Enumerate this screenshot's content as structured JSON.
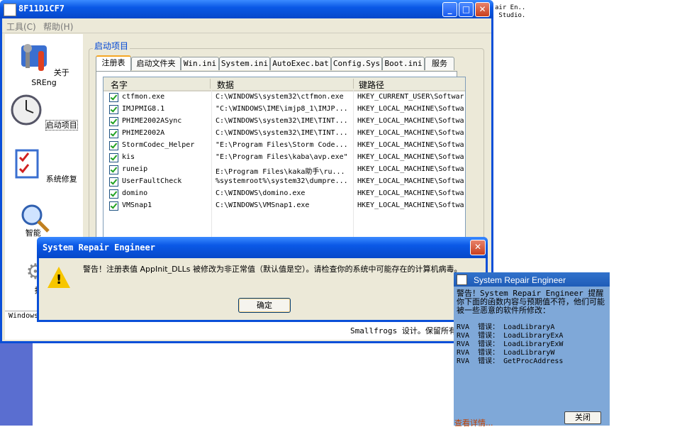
{
  "behind_text": "air En..\n Studio.",
  "main_window": {
    "title": "8F11D1CF7",
    "menu": [
      "工具(C)",
      "帮助(H)"
    ],
    "sidebar": [
      {
        "label": "关于 SREng",
        "icon": "tools-icon"
      },
      {
        "label": "启动项目",
        "icon": "clock-icon"
      },
      {
        "label": "系统修复",
        "icon": "checklist-icon"
      },
      {
        "label": "智能",
        "icon": "magnifier-icon"
      },
      {
        "label": "扫",
        "icon": "gear-icon"
      }
    ],
    "group_label": "启动项目",
    "tabs": [
      "注册表",
      "启动文件夹",
      "Win.ini",
      "System.ini",
      "AutoExec.bat",
      "Config.Sys",
      "Boot.ini",
      "服务"
    ],
    "columns": [
      "名字",
      "数据",
      "键路径"
    ],
    "rows": [
      {
        "name": "ctfmon.exe",
        "data": "C:\\WINDOWS\\system32\\ctfmon.exe",
        "key": "HKEY_CURRENT_USER\\Softwar"
      },
      {
        "name": "IMJPMIG8.1",
        "data": "\"C:\\WINDOWS\\IME\\imjp8_1\\IMJP...",
        "key": "HKEY_LOCAL_MACHINE\\Softwa"
      },
      {
        "name": "PHIME2002ASync",
        "data": "C:\\WINDOWS\\system32\\IME\\TINT...",
        "key": "HKEY_LOCAL_MACHINE\\Softwa"
      },
      {
        "name": "PHIME2002A",
        "data": "C:\\WINDOWS\\system32\\IME\\TINT...",
        "key": "HKEY_LOCAL_MACHINE\\Softwa"
      },
      {
        "name": "StormCodec_Helper",
        "data": "\"E:\\Program Files\\Storm Code...",
        "key": "HKEY_LOCAL_MACHINE\\Softwa"
      },
      {
        "name": "kis",
        "data": "\"E:\\Program Files\\kaba\\avp.exe\"",
        "key": "HKEY_LOCAL_MACHINE\\Softwa"
      },
      {
        "name": "runeip",
        "data": "E:\\Program Files\\kaka助手\\ru...",
        "key": "HKEY_LOCAL_MACHINE\\Softwa"
      },
      {
        "name": "UserFaultCheck",
        "data": "%systemroot%\\system32\\dumpre...",
        "key": "HKEY_LOCAL_MACHINE\\Softwa"
      },
      {
        "name": "domino",
        "data": "C:\\WINDOWS\\domino.exe",
        "key": "HKEY_LOCAL_MACHINE\\Softwa"
      },
      {
        "name": "VMSnap1",
        "data": "C:\\WINDOWS\\VMSnap1.exe",
        "key": "HKEY_LOCAL_MACHINE\\Softwa"
      }
    ],
    "status_left": "Windows",
    "credit": "Smallfrogs 设计。保留所有"
  },
  "alert": {
    "title": "System Repair Engineer",
    "message": "警告！注册表值 AppInit_DLLs 被修改为非正常值（默认值是空）。请检查你的系统中可能存在的计算机病毒。",
    "ok": "确定"
  },
  "notification": {
    "title": "System Repair Engineer",
    "message": "警告！System Repair Engineer 提醒你下面的函数内容与预期值不符，他们可能被一些恶意的软件所修改：",
    "rows": [
      "RVA  错误： LoadLibraryA",
      "RVA  错误： LoadLibraryExA",
      "RVA  错误： LoadLibraryExW",
      "RVA  错误： LoadLibraryW",
      "RVA  错误： GetProcAddress"
    ],
    "close": "关闭",
    "details_link": "查看详情..."
  }
}
